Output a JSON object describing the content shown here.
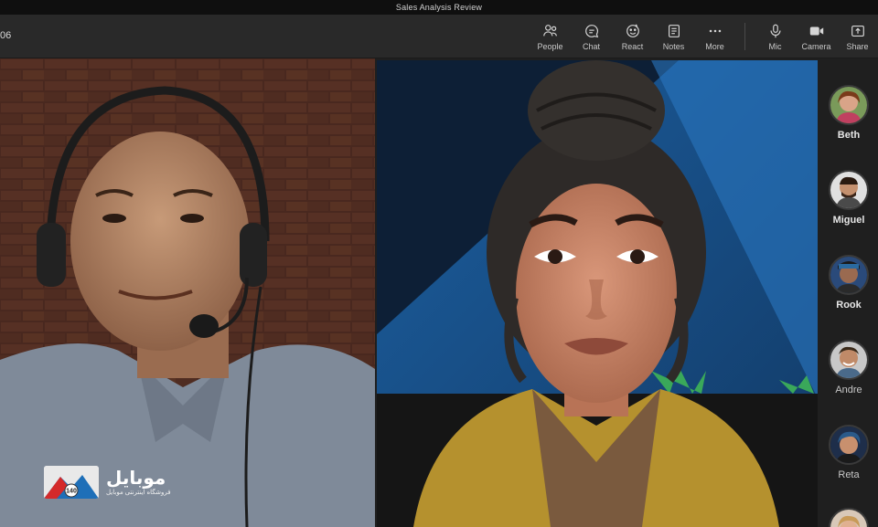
{
  "window": {
    "title": "Sales Analysis Review"
  },
  "call": {
    "timer": "06"
  },
  "toolbar": {
    "items": [
      {
        "id": "people",
        "label": "People",
        "icon": "people-icon"
      },
      {
        "id": "chat",
        "label": "Chat",
        "icon": "chat-icon"
      },
      {
        "id": "react",
        "label": "React",
        "icon": "react-icon"
      },
      {
        "id": "notes",
        "label": "Notes",
        "icon": "notes-icon"
      },
      {
        "id": "more",
        "label": "More",
        "icon": "more-icon"
      },
      {
        "id": "mic",
        "label": "Mic",
        "icon": "mic-icon"
      },
      {
        "id": "camera",
        "label": "Camera",
        "icon": "camera-icon"
      },
      {
        "id": "share",
        "label": "Share",
        "icon": "share-icon"
      }
    ]
  },
  "roster": {
    "participants": [
      {
        "name": "Beth"
      },
      {
        "name": "Miguel"
      },
      {
        "name": "Rook"
      },
      {
        "name": "Andre"
      },
      {
        "name": "Reta"
      }
    ]
  },
  "watermark": {
    "brand": "موبایل",
    "tagline": "فروشگاه اینترنتی موبایل",
    "badge": "140"
  },
  "colors": {
    "toolbar": "#292929",
    "titlebar": "#0f0f0f",
    "roster": "#1f1f1f"
  }
}
